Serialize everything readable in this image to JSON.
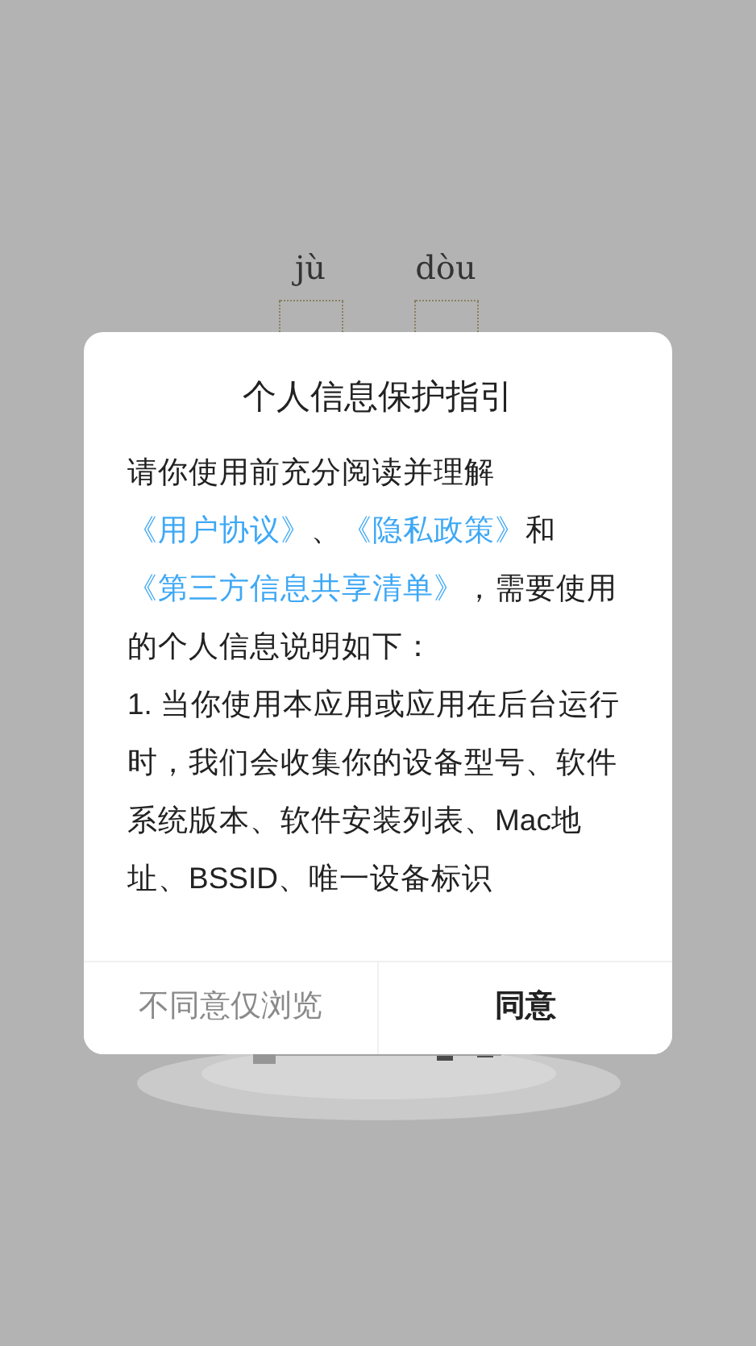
{
  "background": {
    "pinyin": [
      "jù",
      "dòu"
    ],
    "kind": "picture"
  },
  "dialog": {
    "title": "个人信息保护指引",
    "paragraphs": [
      {
        "segments": [
          {
            "kind": "text",
            "text": "请你使用前充分阅读并理解"
          },
          {
            "kind": "link",
            "text": "《用户协议》"
          },
          {
            "kind": "text",
            "text": "、"
          },
          {
            "kind": "link",
            "text": "《隐私政策》"
          },
          {
            "kind": "text",
            "text": "和"
          },
          {
            "kind": "link",
            "text": "《第三方信息共享清单》"
          },
          {
            "kind": "text",
            "text": "，需要使用的个人信息说明如下："
          }
        ]
      },
      {
        "segments": [
          {
            "kind": "text",
            "text": "1. 当你使用本应用或应用在后台运行时，我们会收集你的设备型号、软件系统版本、软件安装列表、Mac地址、BSSID、唯一设备标识"
          }
        ]
      }
    ],
    "buttons": [
      {
        "label": "不同意仅浏览",
        "kind": "secondary"
      },
      {
        "label": "同意",
        "kind": "primary"
      }
    ]
  }
}
